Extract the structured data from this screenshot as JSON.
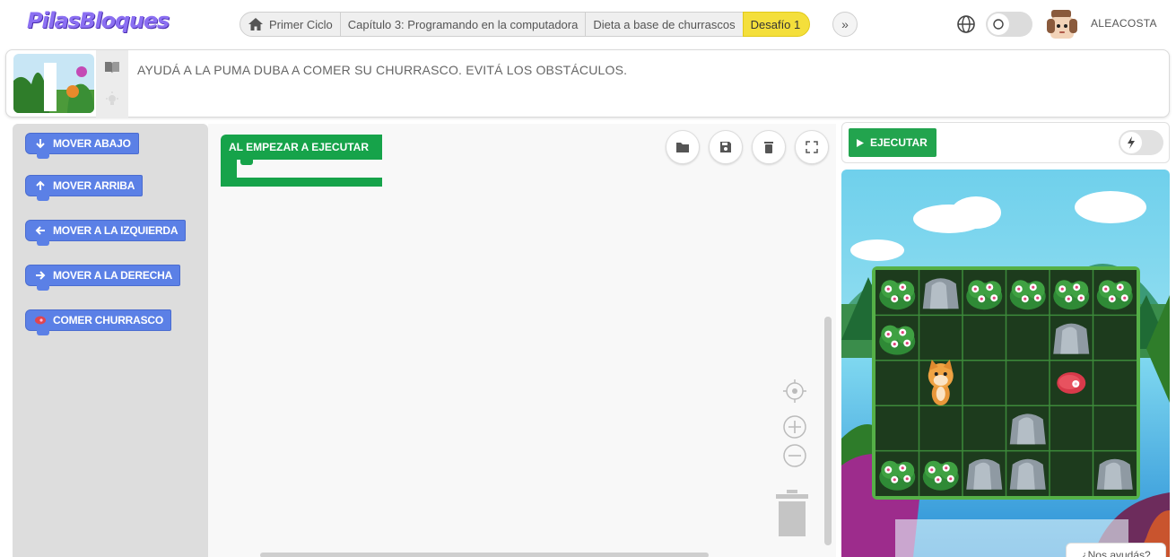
{
  "header": {
    "logo": "PilasBloques",
    "breadcrumb": [
      "Primer Ciclo",
      "Capítulo 3: Programando en la computadora",
      "Dieta a base de churrascos"
    ],
    "challenge_badge": "Desafío 1",
    "next_symbol": "»",
    "username": "ALEACOSTA"
  },
  "instructions": {
    "text": "AYUDÁ A LA PUMA DUBA A COMER SU CHURRASCO. EVITÁ LOS OBSTÁCULOS."
  },
  "toolbox": {
    "blocks": [
      {
        "label": "MOVER ABAJO",
        "icon": "arrow-down-icon"
      },
      {
        "label": "MOVER ARRIBA",
        "icon": "arrow-up-icon"
      },
      {
        "label": "MOVER A LA IZQUIERDA",
        "icon": "arrow-left-icon"
      },
      {
        "label": "MOVER A LA DERECHA",
        "icon": "arrow-right-icon"
      },
      {
        "label": "COMER CHURRASCO",
        "icon": "steak-icon"
      }
    ]
  },
  "workspace": {
    "start_block": "AL EMPEZAR A EJECUTAR",
    "tools": [
      "folder-icon",
      "save-icon",
      "delete-icon",
      "fullscreen-icon"
    ]
  },
  "run": {
    "run_label": "EJECUTAR",
    "help_label": "¿Nos ayudás?"
  },
  "board": {
    "rows": 5,
    "cols": 6,
    "cells": [
      [
        "bush",
        "rock",
        "bush",
        "bush",
        "bush",
        "bush"
      ],
      [
        "bush",
        "empty",
        "empty",
        "empty",
        "rock",
        "empty"
      ],
      [
        "empty",
        "puma",
        "empty",
        "empty",
        "steak",
        "empty"
      ],
      [
        "empty",
        "empty",
        "empty",
        "rock",
        "empty",
        "empty"
      ],
      [
        "bush",
        "bush",
        "rock",
        "rock",
        "empty",
        "rock"
      ]
    ]
  },
  "colors": {
    "block_blue": "#5b80e6",
    "start_green": "#16a34a",
    "run_green": "#22a44e",
    "badge_yellow": "#f4df3b",
    "logo_purple": "#8b6ff2"
  }
}
